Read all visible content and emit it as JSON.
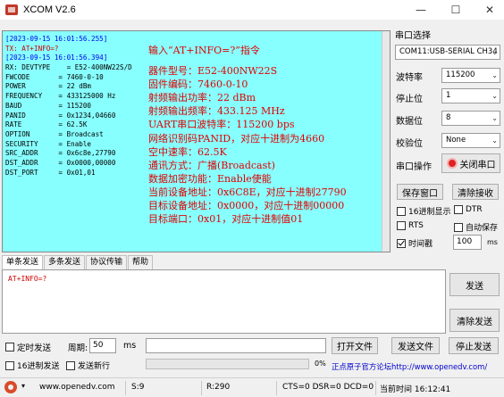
{
  "window": {
    "title": "XCOM V2.6",
    "minimize": "—",
    "maximize": "☐",
    "close": "✕"
  },
  "receive": {
    "lines": [
      {
        "kind": "ts",
        "text": "[2023-09-15 16:01:56.255]"
      },
      {
        "kind": "tx",
        "text": "TX: AT+INFO=?"
      },
      {
        "kind": "ts",
        "text": "[2023-09-15 16:01:56.394]"
      },
      {
        "kind": "rx",
        "text": "RX: DEVTYPE    = E52-400NW22S/D"
      },
      {
        "kind": "rx",
        "text": "FWCODE       = 7460-0-10"
      },
      {
        "kind": "rx",
        "text": "POWER        = 22 dBm"
      },
      {
        "kind": "rx",
        "text": "FREQUENCY    = 433125000 Hz"
      },
      {
        "kind": "rx",
        "text": "BAUD         = 115200"
      },
      {
        "kind": "rx",
        "text": "PANID        = 0x1234,04660"
      },
      {
        "kind": "rx",
        "text": "RATE         = 62.5K"
      },
      {
        "kind": "rx",
        "text": "OPTION       = Broadcast"
      },
      {
        "kind": "rx",
        "text": "SECURITY     = Enable"
      },
      {
        "kind": "rx",
        "text": "SRC_ADDR     = 0x6c8e,27790"
      },
      {
        "kind": "rx",
        "text": "DST_ADDR     = 0x0000,00000"
      },
      {
        "kind": "rx",
        "text": "DST_PORT     = 0x01,01"
      }
    ],
    "annotation_title": "输入“AT+INFO=?”指令",
    "annotations": [
      "器件型号：E52-400NW22S",
      "固件编码：7460-0-10",
      "射频输出功率：22 dBm",
      "射频输出频率：433.125 MHz",
      "UART串口波特率：115200 bps",
      "网络识别码PANID，对应十进制为4660",
      "空中速率：62.5K",
      "通讯方式：广播(Broadcast)",
      "数据加密功能：Enable使能",
      "当前设备地址：0x6C8E，对应十进制27790",
      "目标设备地址：0x0000，对应十进制00000",
      "目标端口：0x01，对应十进制值01"
    ]
  },
  "port": {
    "section_label": "串口选择",
    "port_value": "COM11:USB-SERIAL CH34",
    "baud_label": "波特率",
    "baud_value": "115200",
    "stopbit_label": "停止位",
    "stopbit_value": "1",
    "databit_label": "数据位",
    "databit_value": "8",
    "parity_label": "校验位",
    "parity_value": "None",
    "op_label": "串口操作",
    "close_port_button": "关闭串口",
    "save_window_button": "保存窗口",
    "clear_receive_button": "清除接收",
    "hex_display_label": "16进制显示",
    "dtr_label": "DTR",
    "rts_label": "RTS",
    "auto_save_label": "自动保存",
    "timestamp_label": "时间戳",
    "timestamp_value": "100",
    "ms_unit": "ms"
  },
  "send": {
    "tabs": [
      "单条发送",
      "多条发送",
      "协议传输",
      "帮助"
    ],
    "text": "AT+INFO=?",
    "send_button": "发送",
    "clear_send_button": "清除发送",
    "timed_send_label": "定时发送",
    "period_label": "周期:",
    "period_value": "50",
    "period_unit": "ms",
    "open_file_button": "打开文件",
    "send_file_button": "发送文件",
    "stop_send_button": "停止发送",
    "hex_send_label": "16进制发送",
    "newline_label": "发送新行",
    "progress": "0%",
    "forum_link": "正点原子官方论坛http://www.openedv.com/"
  },
  "status": {
    "url": "www.openedv.com",
    "s": "S:9",
    "r": "R:290",
    "signals": "CTS=0 DSR=0 DCD=0",
    "time": "当前时间 16:12:41"
  }
}
